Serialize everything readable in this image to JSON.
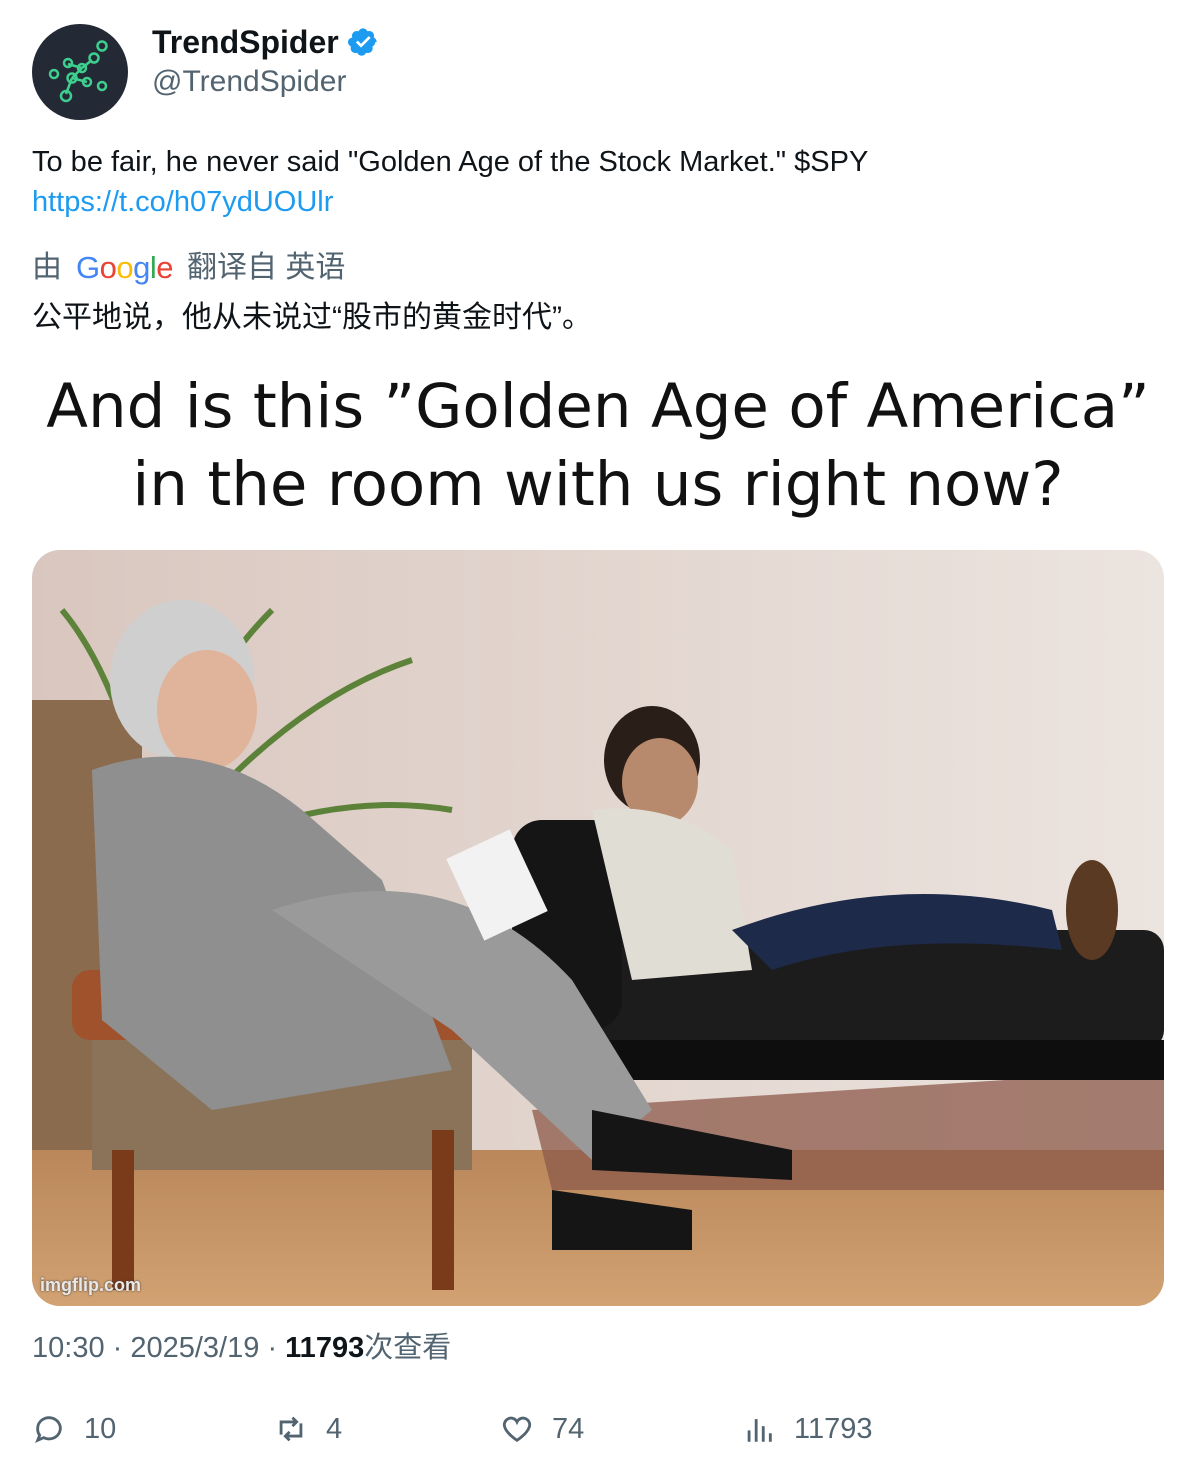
{
  "author": {
    "name": "TrendSpider",
    "handle": "@TrendSpider",
    "verified_icon": "verified-badge-icon",
    "avatar_icon": "trendspider-logo-icon",
    "verified_color": "#1d9bf0"
  },
  "tweet": {
    "text": "To be fair, he never said \"Golden Age of the Stock Market.\"  $SPY",
    "link": "https://t.co/h07ydUOUlr"
  },
  "translation": {
    "prefix": "由",
    "provider": "Google",
    "suffix": "翻译自 英语",
    "text": "公平地说，他从未说过“股市的黄金时代”。"
  },
  "media": {
    "caption_line1": "And is this ”Golden Age of America”",
    "caption_line2": "in the room with us right now?",
    "watermark": "imgflip.com"
  },
  "meta": {
    "time": "10:30",
    "date": "2025/3/19",
    "views": "11793",
    "views_suffix": "次查看"
  },
  "actions": {
    "reply_count": "10",
    "retweet_count": "4",
    "like_count": "74",
    "view_count": "11793"
  },
  "colors": {
    "link": "#1d9bf0",
    "secondary_text": "#536471",
    "primary_text": "#0f1419"
  }
}
